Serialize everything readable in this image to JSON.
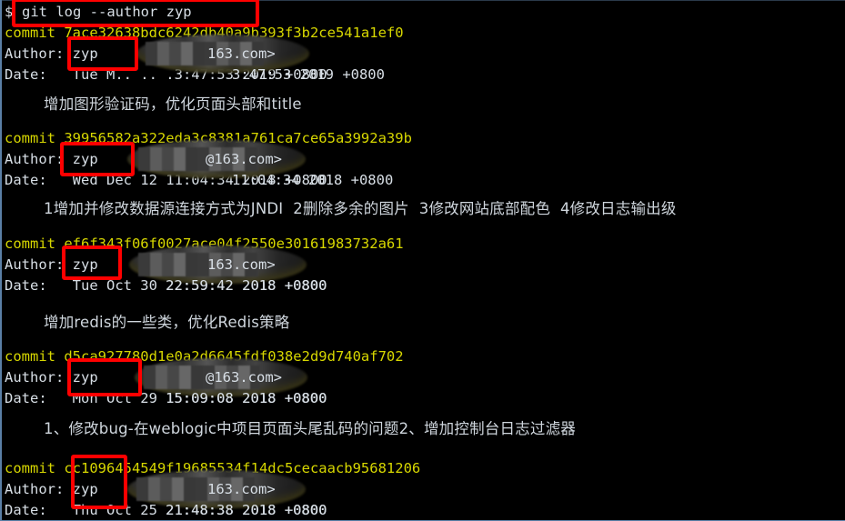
{
  "terminal": {
    "prompt_symbol": "$",
    "command": "git log --author zyp",
    "author_name": "zyp",
    "email_suffix": "163.com>",
    "email_suffix_at": "@163.com>",
    "labels": {
      "commit": "commit",
      "author": "Author:",
      "date": "Date:"
    },
    "colors": {
      "background": "#000000",
      "commit_hash": "#d7d700",
      "text": "#d8dfe6",
      "annotation": "#ff0000",
      "left_rule": "#5a7fa6"
    },
    "commits": [
      {
        "hash": "7ace32638bdc6242db40a9b393f3b2ce541a1ef0",
        "commit_line": "commit 7ace32638bdc6242db40a9b393f3b2ce541a1ef0",
        "author_line": "Author: zyp",
        "date_line": "Date:   Tue M.. .. .3:47:53 2019 +0800",
        "date_visible": "Tue M",
        "date_tail": "3:47:53 2019 +0800",
        "year": "2019",
        "timezone": "+0800",
        "message": "增加图形验证码，优化页面头部和title"
      },
      {
        "hash": "39956582a322eda3c8381a761ca7ce65a3992a39b",
        "commit_line": "commit 39956582a322eda3c8381a761ca7ce65a3992a39b",
        "author_line": "Author: zyp",
        "date_line": "Date:   Wed Dec 12 11:04:34 2018 +0800",
        "date_visible": "Wed Dec",
        "date_tail": "11:04:34 2018 +0800",
        "year": "2018",
        "timezone": "+0800",
        "message": "1增加并修改数据源连接方式为JNDI  2删除多余的图片  3修改网站底部配色  4修改日志输出级"
      },
      {
        "hash": "ef6f343f06f0027ace04f2550e30161983732a61",
        "commit_line": "commit ef6f343f06f0027ace04f2550e30161983732a61",
        "author_line": "Author: zyp",
        "date_line": "Date:   Tue Oct 30 22:59:42 2018 +0800",
        "date_visible": "Tue Oct 30",
        "date_tail": "22:59:42 2018 +0800",
        "year": "2018",
        "timezone": "+0800",
        "message": "增加redis的一些类，优化Redis策略"
      },
      {
        "hash": "d5ca927780d1e0a2d6645fdf038e2d9d740af702",
        "commit_line": "commit d5ca927780d1e0a2d6645fdf038e2d9d740af702",
        "author_line": "Author: zyp",
        "date_line": "Date:   Mon Oct 29 15:09:08 2018 +0800",
        "date_visible": "Mon Oct 29",
        "date_tail": "15:09:08 2018 +0800",
        "year": "2018",
        "timezone": "+0800",
        "message": "1、修改bug-在weblogic中项目页面头尾乱码的问题2、增加控制台日志过滤器"
      },
      {
        "hash": "cc1096454549f19685534f14dc5cecaacb95681206",
        "commit_line": "commit cc1096454549f19685534f14dc5cecaacb95681206",
        "author_line": "Author: zyp",
        "date_line": "Date:   Thu Oct 25 21:48:38 2018 +0800",
        "date_visible": "Thu Oct 25",
        "date_tail": "21:48:38 2018 +0800",
        "year": "2018",
        "timezone": "+0800",
        "message": ""
      }
    ],
    "annotations": [
      {
        "label": "command-highlight"
      },
      {
        "label": "author-highlight-1"
      },
      {
        "label": "author-highlight-2"
      },
      {
        "label": "author-highlight-3"
      },
      {
        "label": "author-highlight-4"
      },
      {
        "label": "author-highlight-5"
      }
    ]
  }
}
